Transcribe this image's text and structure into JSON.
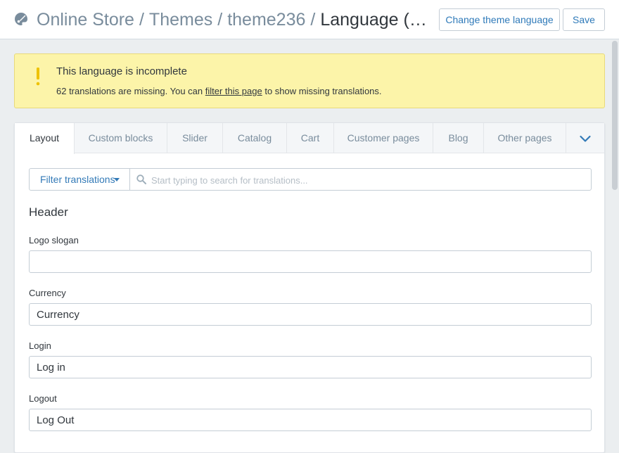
{
  "header": {
    "breadcrumb": {
      "store": "Online Store",
      "themes": "Themes",
      "theme": "theme236",
      "current": "Language (English)"
    },
    "separator": "/",
    "change_language_label": "Change theme language",
    "save_label": "Save",
    "app_icon": "paint-palette-icon"
  },
  "banner": {
    "title": "This language is incomplete",
    "text_before": "62 translations are missing. You can",
    "link": "filter this page",
    "text_after": "to show missing translations.",
    "icon": "exclamation-icon",
    "accent": "#eec200"
  },
  "tabs": {
    "items": [
      "Layout",
      "Custom blocks",
      "Slider",
      "Catalog",
      "Cart",
      "Customer pages",
      "Blog",
      "Other pages"
    ],
    "active": "Layout",
    "more_icon": "chevron-down-icon"
  },
  "filter": {
    "button_label": "Filter translations",
    "search_placeholder": "Start typing to search for translations..."
  },
  "section": {
    "title": "Header",
    "fields": [
      {
        "label": "Logo slogan",
        "value": ""
      },
      {
        "label": "Currency",
        "value": "Currency"
      },
      {
        "label": "Login",
        "value": "Log in"
      },
      {
        "label": "Logout",
        "value": "Log Out"
      }
    ]
  },
  "colors": {
    "link": "#337ab7",
    "banner_bg": "#fcf4a9",
    "page_bg": "#ebeef0"
  }
}
